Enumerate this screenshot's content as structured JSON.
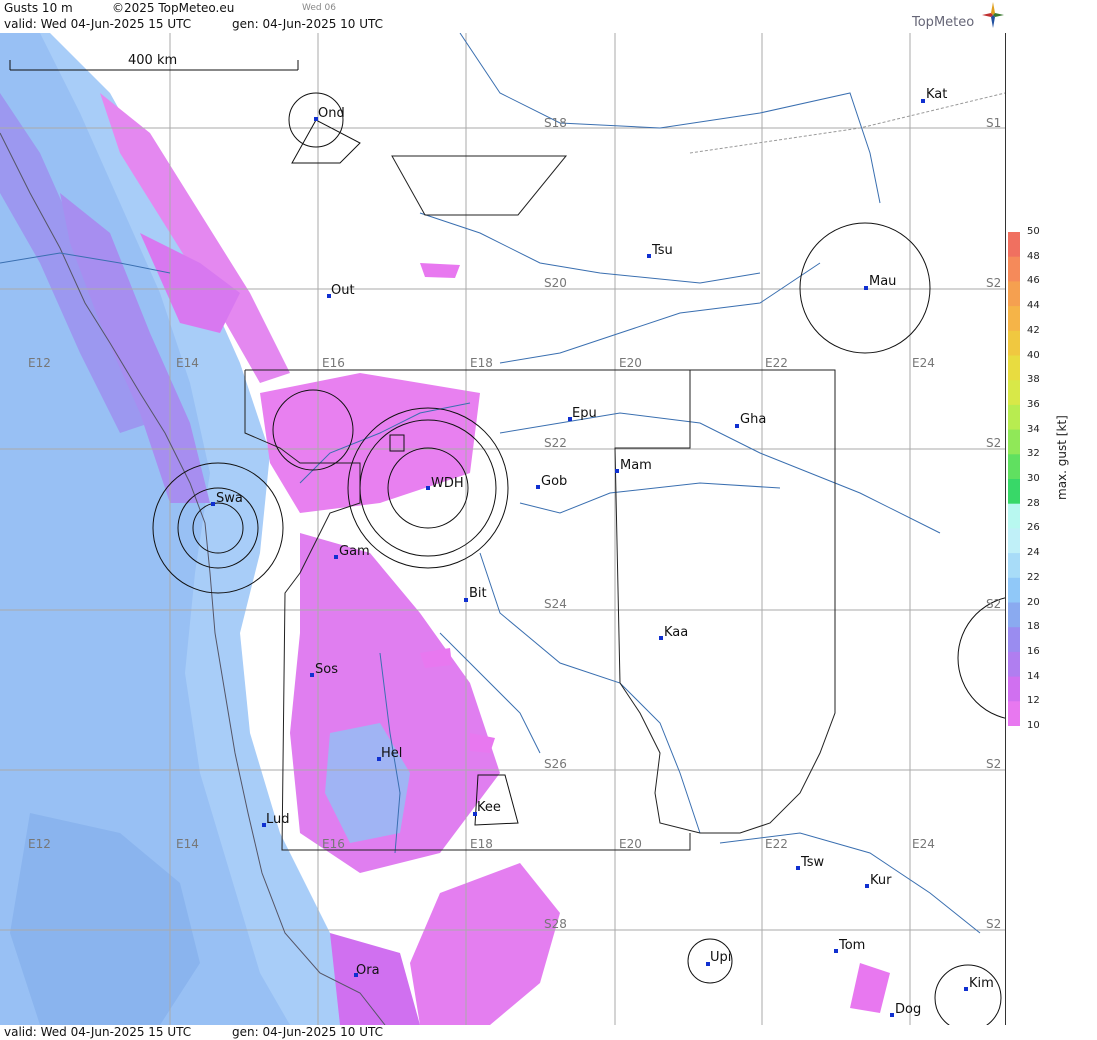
{
  "header": {
    "title": "Gusts 10 m",
    "copyright": "©2025 TopMeteo.eu",
    "valid": "valid:  Wed  04-Jun-2025  15 UTC",
    "generated": "gen: 04-Jun-2025 10 UTC",
    "day_tab": "Wed 06",
    "brand": "TopMeteo"
  },
  "footer": {
    "valid": "valid:  Wed  04-Jun-2025  15 UTC",
    "generated": "gen: 04-Jun-2025 10 UTC"
  },
  "scale_bar": {
    "label": "400 km"
  },
  "legend": {
    "title": "max. gust [kt]",
    "ticks": [
      "50",
      "48",
      "46",
      "44",
      "42",
      "40",
      "38",
      "36",
      "34",
      "32",
      "30",
      "28",
      "26",
      "24",
      "22",
      "20",
      "18",
      "16",
      "14",
      "12",
      "10"
    ],
    "colors": [
      "#f07060",
      "#f58a5a",
      "#f5a050",
      "#f5b448",
      "#f0c840",
      "#e8dc40",
      "#d8e848",
      "#b8ec50",
      "#90e858",
      "#60e060",
      "#38d868",
      "#b8f8f0",
      "#c0f0f8",
      "#a8dcf8",
      "#90c8f8",
      "#8aaaf0",
      "#9a8cf0",
      "#b07ef0",
      "#d070f0",
      "#e878f0"
    ]
  },
  "grid_labels": {
    "longitude": [
      "E12",
      "E14",
      "E16",
      "E18",
      "E20",
      "E22",
      "E24"
    ],
    "latitude": [
      "S18",
      "S20",
      "S22",
      "S24",
      "S26",
      "S28"
    ],
    "edge": [
      "S1",
      "S2",
      "S2",
      "S2",
      "S2",
      "S2"
    ]
  },
  "cities": [
    {
      "name": "Ond"
    },
    {
      "name": "Kat"
    },
    {
      "name": "Tsu"
    },
    {
      "name": "Out"
    },
    {
      "name": "Mau"
    },
    {
      "name": "Epu"
    },
    {
      "name": "Gha"
    },
    {
      "name": "Mam"
    },
    {
      "name": "Swa"
    },
    {
      "name": "WDH"
    },
    {
      "name": "Gob"
    },
    {
      "name": "Gam"
    },
    {
      "name": "Bit"
    },
    {
      "name": "Kaa"
    },
    {
      "name": "Sos"
    },
    {
      "name": "Hel"
    },
    {
      "name": "Kee"
    },
    {
      "name": "Lud"
    },
    {
      "name": "Tsw"
    },
    {
      "name": "Kur"
    },
    {
      "name": "Tom"
    },
    {
      "name": "Upi"
    },
    {
      "name": "Ora"
    },
    {
      "name": "Kim"
    },
    {
      "name": "Dog"
    }
  ]
}
